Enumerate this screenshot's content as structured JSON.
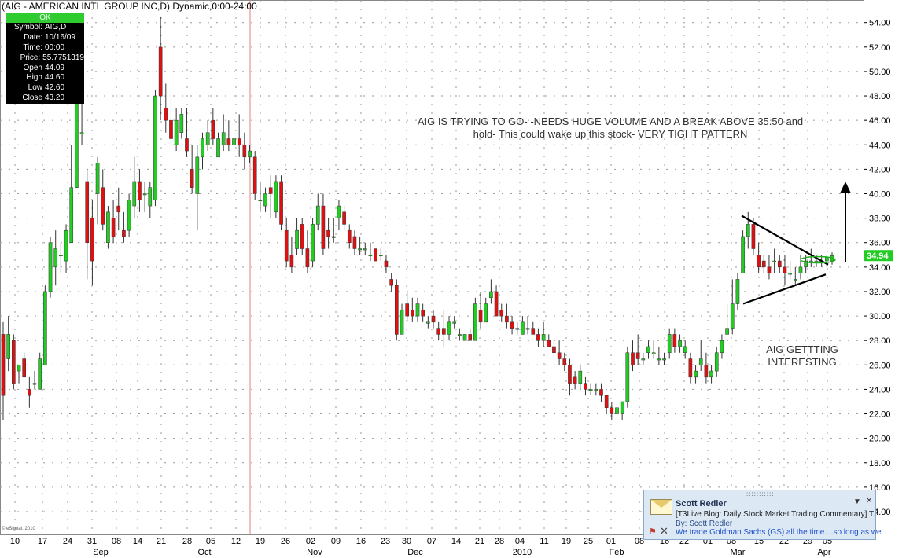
{
  "title": "(AIG - AMERICAN INTL GROUP INC,D) Dynamic,0:00-24:00",
  "info_box": {
    "status": "OK",
    "rows": [
      {
        "k": "Symbol:",
        "v": "AIG,D"
      },
      {
        "k": "Date:",
        "v": "10/16/09"
      },
      {
        "k": "Time:",
        "v": "00:00"
      },
      {
        "k": "Price:",
        "v": "55.7751319"
      },
      {
        "k": "Open",
        "v": "44.09"
      },
      {
        "k": "High",
        "v": "44.60"
      },
      {
        "k": "Low",
        "v": "42.60"
      },
      {
        "k": "Close",
        "v": "43.20"
      }
    ]
  },
  "annotations": {
    "note1_line1": "AIG IS TRYING TO GO-  -NEEDS HUGE VOLUME AND A BREAK ABOVE 35.50 and",
    "note1_line2": "hold-  This could wake up this stock- VERY TIGHT PATTERN",
    "note2_line1": "AIG GETTTING",
    "note2_line2": "INTERESTING",
    "copyright": "© eSignal, 2010"
  },
  "notification": {
    "sender": "Scott Redler",
    "subject": "[T3Live Blog: Daily Stock Market Trading Commentary] T...",
    "by": "By: Scott Redler",
    "preview": "We trade Goldman Sachs (GS) all the time....so long as we"
  },
  "chart_data": {
    "type": "candlestick",
    "colors": {
      "up": "#22cc22",
      "down": "#dd1111",
      "grid": "#9a9a9a",
      "marker_line": "#e08080",
      "price_tag": "#22cc22",
      "trendline": "#000000"
    },
    "ylim": [
      13.5,
      55
    ],
    "y_ticks": [
      14,
      16,
      18,
      20,
      22,
      24,
      26,
      28,
      30,
      32,
      34,
      36,
      38,
      40,
      42,
      44,
      46,
      48,
      50,
      52,
      54
    ],
    "y_tick_labels": [
      "14.00",
      "16.00",
      "18.00",
      "20.00",
      "22.00",
      "24.00",
      "26.00",
      "28.00",
      "30.00",
      "32.00",
      "34.00",
      "36.00",
      "38.00",
      "40.00",
      "42.00",
      "44.00",
      "46.00",
      "48.00",
      "50.00",
      "52.00",
      "54.00"
    ],
    "x_day_labels": [
      "10",
      "17",
      "24",
      "31",
      "08",
      "14",
      "21",
      "28",
      "05",
      "12",
      "19",
      "26",
      "02",
      "09",
      "16",
      "23",
      "30",
      "07",
      "14",
      "21",
      "28",
      "04",
      "11",
      "19",
      "25",
      "01",
      "08",
      "16",
      "22",
      "01",
      "08",
      "15",
      "22",
      "29",
      "05"
    ],
    "x_month_labels": [
      "Sep",
      "Oct",
      "Nov",
      "Dec",
      "2010",
      "Feb",
      "Mar",
      "Apr"
    ],
    "last_price": "34.94",
    "last_price_value": 34.94,
    "grid": true,
    "ohlc": [
      [
        28.5,
        29.5,
        21.5,
        23.5
      ],
      [
        26.5,
        30,
        25.5,
        28.5
      ],
      [
        28,
        28.5,
        24,
        24.5
      ],
      [
        25.5,
        26,
        24.5,
        26
      ],
      [
        26.5,
        27,
        25,
        25
      ],
      [
        24,
        25,
        22.5,
        23.5
      ],
      [
        24.5,
        25.5,
        24,
        24.5
      ],
      [
        24,
        27,
        24,
        26.5
      ],
      [
        26,
        32.5,
        26,
        32
      ],
      [
        32,
        36.5,
        31.5,
        36
      ],
      [
        34,
        37,
        32.5,
        35.5
      ],
      [
        35,
        36,
        33.5,
        35
      ],
      [
        34.5,
        37.5,
        33.5,
        37
      ],
      [
        36,
        44,
        36,
        40.5
      ],
      [
        40.5,
        52,
        40.5,
        51.5
      ],
      [
        45,
        47.5,
        44,
        45
      ],
      [
        41,
        42,
        33,
        36
      ],
      [
        38,
        39.5,
        32.5,
        34.5
      ],
      [
        40,
        43,
        37.5,
        42.5
      ],
      [
        40.5,
        42,
        37,
        37.5
      ],
      [
        36,
        39,
        35.5,
        38.5
      ],
      [
        38,
        39.5,
        36,
        36.5
      ],
      [
        39,
        40.5,
        37,
        38.5
      ],
      [
        37,
        38.5,
        36,
        36.5
      ],
      [
        37,
        40,
        36.5,
        39.5
      ],
      [
        39,
        43,
        38,
        41
      ],
      [
        41,
        42,
        38.5,
        39.5
      ],
      [
        40,
        41,
        38.5,
        40
      ],
      [
        39,
        41,
        38,
        40.5
      ],
      [
        39.5,
        48.5,
        39,
        48
      ],
      [
        52,
        54.5,
        46,
        48
      ],
      [
        47,
        49,
        45,
        46
      ],
      [
        46,
        48.5,
        44,
        44.5
      ],
      [
        44,
        47,
        43.5,
        46
      ],
      [
        45,
        47,
        44.5,
        46.5
      ],
      [
        44.5,
        47,
        43,
        43.5
      ],
      [
        42,
        44,
        40,
        40.5
      ],
      [
        40,
        44,
        37,
        43
      ],
      [
        43,
        45,
        42,
        44.5
      ],
      [
        44,
        46,
        43.5,
        45
      ],
      [
        46,
        47,
        44,
        44.5
      ],
      [
        43,
        45,
        43,
        44.5
      ],
      [
        44,
        46.5,
        43.5,
        45
      ],
      [
        44.5,
        46,
        43.5,
        44
      ],
      [
        44,
        45,
        43.5,
        44.5
      ],
      [
        44.5,
        46.5,
        43,
        44
      ],
      [
        44,
        45,
        42,
        43
      ],
      [
        43,
        44,
        42.5,
        43.5
      ],
      [
        43,
        43.5,
        39.5,
        40
      ],
      [
        39.5,
        41,
        38.5,
        39.5
      ],
      [
        39,
        40.5,
        38.5,
        40
      ],
      [
        40.5,
        41.5,
        38,
        40
      ],
      [
        38.5,
        41.5,
        38,
        41
      ],
      [
        41,
        41.5,
        37,
        37.5
      ],
      [
        37,
        38,
        34,
        34.5
      ],
      [
        35,
        36.5,
        33.5,
        34
      ],
      [
        35.5,
        38,
        35,
        37
      ],
      [
        37.5,
        38,
        35,
        35.5
      ],
      [
        35.5,
        37,
        33.5,
        34
      ],
      [
        34.5,
        38,
        34,
        37.5
      ],
      [
        37.5,
        40,
        37,
        39
      ],
      [
        39,
        40,
        35,
        35.5
      ],
      [
        37,
        38,
        35.5,
        36.5
      ],
      [
        36.5,
        38,
        36,
        36.5
      ],
      [
        38,
        39.5,
        37,
        39
      ],
      [
        38.5,
        39,
        37,
        37.5
      ],
      [
        37,
        37.5,
        35.5,
        36
      ],
      [
        36.5,
        37,
        35,
        35.5
      ],
      [
        35.5,
        36.5,
        35,
        35.5
      ],
      [
        35.5,
        36,
        35,
        35.5
      ],
      [
        35,
        36,
        34.5,
        35
      ],
      [
        35.5,
        35.5,
        34.5,
        34.5
      ],
      [
        35,
        35.5,
        34.5,
        35
      ],
      [
        34.5,
        35,
        33.5,
        34
      ],
      [
        33,
        33.5,
        32,
        32.5
      ],
      [
        32.5,
        33,
        28,
        28.5
      ],
      [
        28.5,
        31,
        28.5,
        30.5
      ],
      [
        31,
        32,
        29.5,
        30
      ],
      [
        30.5,
        31.5,
        29.5,
        30
      ],
      [
        30,
        31.5,
        29.5,
        31
      ],
      [
        30.5,
        31,
        29.5,
        30
      ],
      [
        29.5,
        30,
        29,
        29.5
      ],
      [
        30,
        30.5,
        29,
        29.5
      ],
      [
        29,
        29.5,
        28,
        28.5
      ],
      [
        29,
        30.5,
        27.5,
        28.5
      ],
      [
        28.5,
        30,
        28,
        29.5
      ],
      [
        29.5,
        30,
        29,
        29.5
      ],
      [
        28.5,
        29,
        28,
        28.5
      ],
      [
        28,
        28.5,
        28,
        28.5
      ],
      [
        28.5,
        29,
        28,
        28
      ],
      [
        28,
        31.5,
        28,
        31
      ],
      [
        30.5,
        32,
        29,
        29.5
      ],
      [
        29.5,
        31.5,
        29.5,
        31
      ],
      [
        31.5,
        33,
        31,
        32
      ],
      [
        32,
        32.5,
        30,
        30
      ],
      [
        30.5,
        31,
        29.5,
        30
      ],
      [
        30,
        31,
        29,
        29.5
      ],
      [
        29.5,
        30,
        28.5,
        29
      ],
      [
        29,
        29.5,
        28.5,
        29
      ],
      [
        28.5,
        30,
        28.5,
        29.5
      ],
      [
        29,
        30,
        28.5,
        29
      ],
      [
        29,
        29.5,
        28.5,
        28.5
      ],
      [
        28.5,
        29,
        27.5,
        28
      ],
      [
        28,
        29.5,
        27.5,
        28.5
      ],
      [
        28,
        28.5,
        27.5,
        27.5
      ],
      [
        27.5,
        28,
        26.5,
        27
      ],
      [
        27,
        28,
        26,
        26.5
      ],
      [
        26.5,
        27,
        25.5,
        26
      ],
      [
        26,
        26.5,
        23.5,
        24.5
      ],
      [
        25,
        25.5,
        24,
        24.5
      ],
      [
        24.5,
        26,
        24,
        25.5
      ],
      [
        24.5,
        25,
        23.5,
        24
      ],
      [
        24,
        24.5,
        23.5,
        24
      ],
      [
        24,
        24.5,
        23.5,
        24
      ],
      [
        24,
        24.5,
        23,
        23.5
      ],
      [
        23.5,
        23.5,
        22,
        22.5
      ],
      [
        22.5,
        23,
        21.5,
        22
      ],
      [
        22,
        23,
        21.5,
        22.5
      ],
      [
        22,
        23,
        21.5,
        23
      ],
      [
        23,
        27.5,
        22.5,
        27
      ],
      [
        27,
        28,
        25.5,
        26
      ],
      [
        27,
        28.5,
        26,
        26.5
      ],
      [
        26.5,
        27,
        26,
        26.5
      ],
      [
        27,
        28,
        26.5,
        27.5
      ],
      [
        27,
        28,
        26.5,
        27
      ],
      [
        26.5,
        27.5,
        26,
        26.5
      ],
      [
        26.5,
        27,
        26,
        26.5
      ],
      [
        27,
        29,
        26.5,
        28.5
      ],
      [
        28.5,
        29,
        27,
        27.5
      ],
      [
        27.5,
        28.5,
        27,
        28
      ],
      [
        27,
        28,
        26.5,
        27.5
      ],
      [
        26.5,
        27,
        24.5,
        25
      ],
      [
        25,
        26,
        24.5,
        25.5
      ],
      [
        26,
        28,
        25.5,
        26.5
      ],
      [
        26,
        27,
        24.5,
        25
      ],
      [
        25,
        26,
        24.5,
        25.5
      ],
      [
        25.5,
        27.5,
        25,
        27
      ],
      [
        27,
        28.5,
        26.5,
        28
      ],
      [
        28.5,
        31,
        28.5,
        29
      ],
      [
        29,
        33,
        28.5,
        31
      ],
      [
        31,
        33.5,
        30.5,
        33
      ],
      [
        33.5,
        37,
        33.5,
        36.5
      ],
      [
        36.5,
        38.5,
        35.5,
        37.5
      ],
      [
        37.5,
        38,
        35,
        35.5
      ],
      [
        35,
        36,
        33.5,
        34
      ],
      [
        34.5,
        35,
        33.5,
        34
      ],
      [
        34,
        35,
        33,
        33.5
      ],
      [
        34.5,
        35.5,
        33.5,
        34.5
      ],
      [
        34.5,
        35,
        33.5,
        34
      ],
      [
        34,
        35,
        32.5,
        33.5
      ],
      [
        33.5,
        34.5,
        33,
        33.5
      ],
      [
        33,
        34,
        32.5,
        33
      ],
      [
        33.5,
        35,
        33,
        34
      ],
      [
        34,
        35,
        33.5,
        34.5
      ],
      [
        34.5,
        35.5,
        34,
        34.5
      ],
      [
        34.5,
        35,
        34,
        34.5
      ],
      [
        34.5,
        35,
        34,
        34.5
      ],
      [
        34.5,
        35,
        34,
        34.8
      ],
      [
        34.5,
        35.2,
        34.2,
        34.94
      ]
    ]
  }
}
